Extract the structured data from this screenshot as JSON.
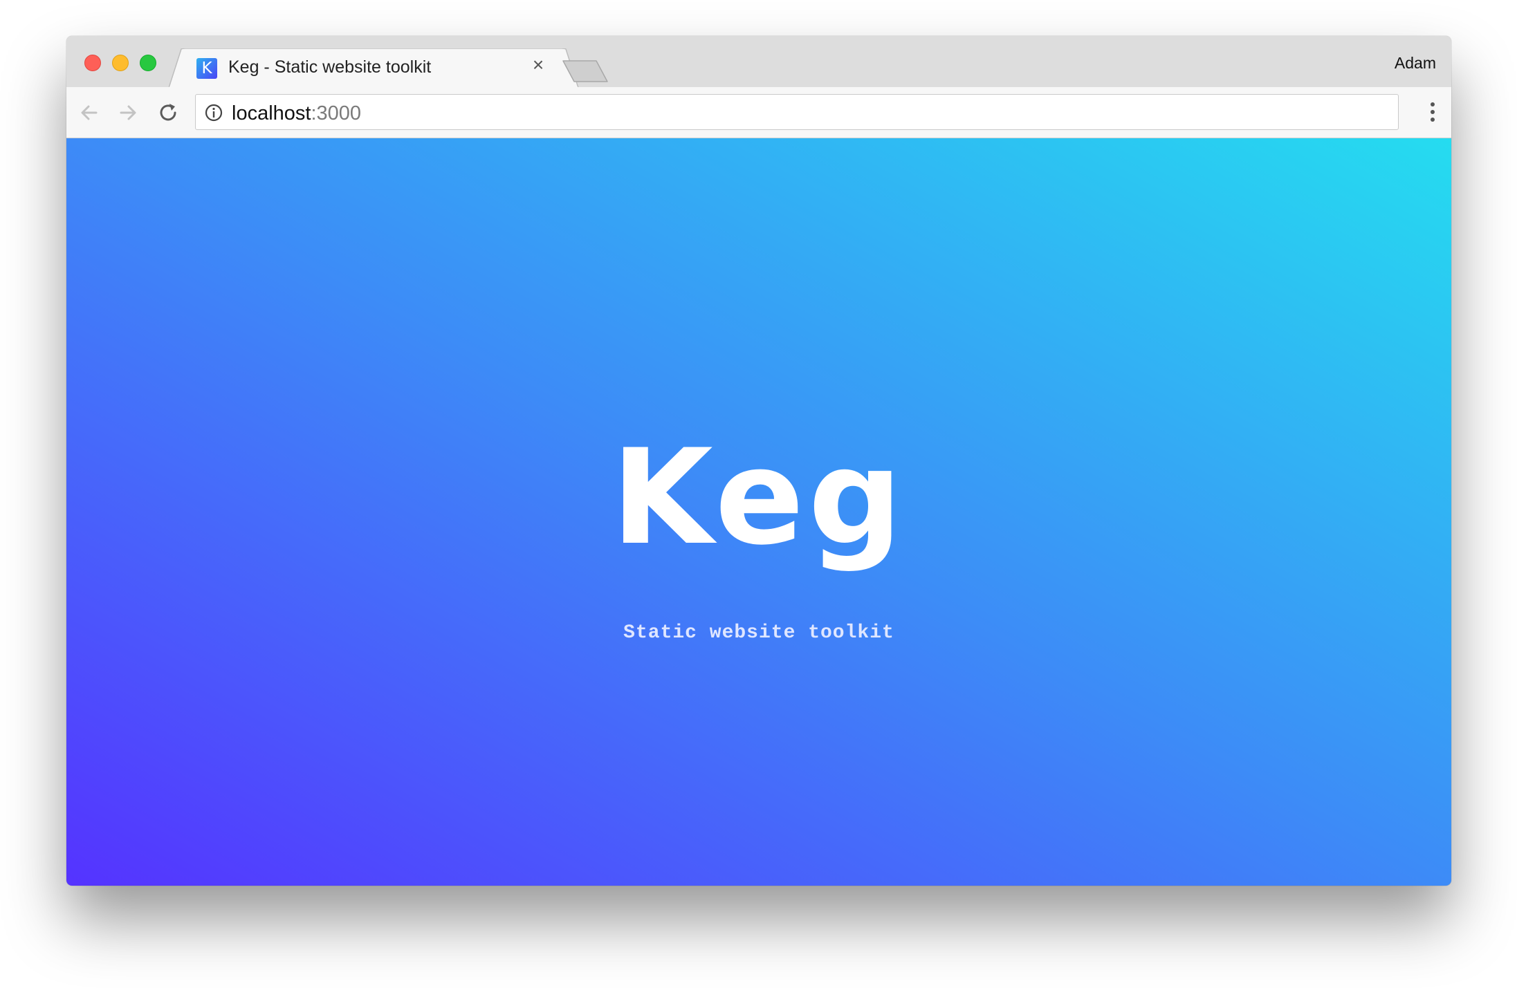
{
  "browser": {
    "tab": {
      "favicon_letter": "K",
      "title": "Keg - Static website toolkit",
      "close_glyph": "×"
    },
    "profile_name": "Adam",
    "address": {
      "host": "localhost",
      "port": ":3000"
    },
    "icons": {
      "back": "arrow-left-icon",
      "forward": "arrow-right-icon",
      "reload": "reload-icon",
      "info": "info-circle-icon",
      "menu": "vertical-dots-icon"
    }
  },
  "page": {
    "logo": "Keg",
    "tagline": "Static website toolkit",
    "gradient": {
      "bottom_left": "#5533ff",
      "middle": "#3d8bf7",
      "top_right": "#25dcf0"
    }
  }
}
